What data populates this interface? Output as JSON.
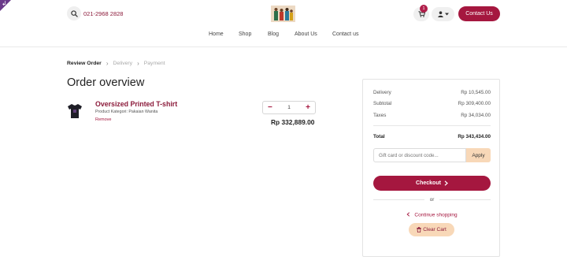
{
  "header": {
    "phone": "021-2968 2828",
    "cart_count": "1",
    "contact_label": "Contact Us",
    "icons": {
      "search": "search-icon",
      "cart": "cart-icon",
      "user": "user-icon",
      "user_caret": "caret-down-icon"
    }
  },
  "nav": {
    "items": [
      {
        "label": "Home"
      },
      {
        "label": "Shop"
      },
      {
        "label": "Blog"
      },
      {
        "label": "About Us"
      },
      {
        "label": "Contact us"
      }
    ]
  },
  "steps": {
    "items": [
      {
        "label": "Review Order",
        "state": "active"
      },
      {
        "label": "Delivery",
        "state": "inactive"
      },
      {
        "label": "Payment",
        "state": "inactive"
      }
    ],
    "separator": "›"
  },
  "order": {
    "title": "Order overview",
    "item": {
      "name": "Oversized Printed T-shirt",
      "category": "Product Kategori: Pakaian Wanita",
      "remove_label": "Remove",
      "quantity": "1",
      "minus_label": "−",
      "plus_label": "+",
      "price": "Rp 332,889.00"
    }
  },
  "summary": {
    "rows": [
      {
        "label": "Delivery",
        "value": "Rp 10,545.00"
      },
      {
        "label": "Subtotal",
        "value": "Rp 309,400.00"
      },
      {
        "label": "Taxes",
        "value": "Rp 34,034.00"
      }
    ],
    "total_label": "Total",
    "total_value": "Rp 343,434.00",
    "gift_placeholder": "Gift card or discount code...",
    "apply_label": "Apply",
    "checkout_label": "Checkout",
    "or_label": "or",
    "continue_label": "Continue shopping",
    "clear_label": "Clear Cart"
  },
  "colors": {
    "brand": "#a5173f",
    "brand_dark": "#8b1a3a",
    "peach": "#f8d8b8"
  }
}
